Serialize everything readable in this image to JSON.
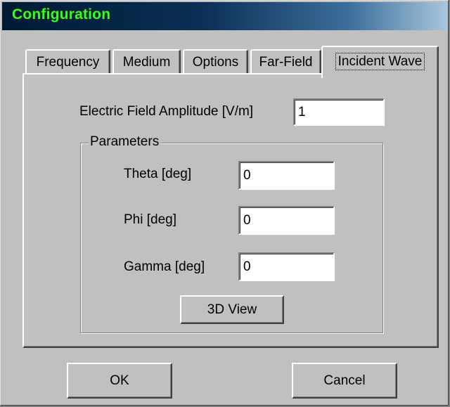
{
  "window": {
    "title": "Configuration"
  },
  "tabs": [
    {
      "label": "Frequency",
      "active": false
    },
    {
      "label": "Medium",
      "active": false
    },
    {
      "label": "Options",
      "active": false
    },
    {
      "label": "Far-Field",
      "active": false
    },
    {
      "label": "Incident Wave",
      "active": true
    }
  ],
  "incident_wave": {
    "amplitude_label": "Electric Field Amplitude [V/m]",
    "amplitude_value": "1",
    "parameters": {
      "group_label": "Parameters",
      "theta_label": "Theta [deg]",
      "theta_value": "0",
      "phi_label": "Phi [deg]",
      "phi_value": "0",
      "gamma_label": "Gamma [deg]",
      "gamma_value": "0",
      "view_button_label": "3D View"
    }
  },
  "footer": {
    "ok_label": "OK",
    "cancel_label": "Cancel"
  },
  "colors": {
    "title_text": "#39ff14",
    "title_gradient_start": "#001a33",
    "title_gradient_end": "#a8c6dc",
    "face": "#c0c0c0"
  }
}
